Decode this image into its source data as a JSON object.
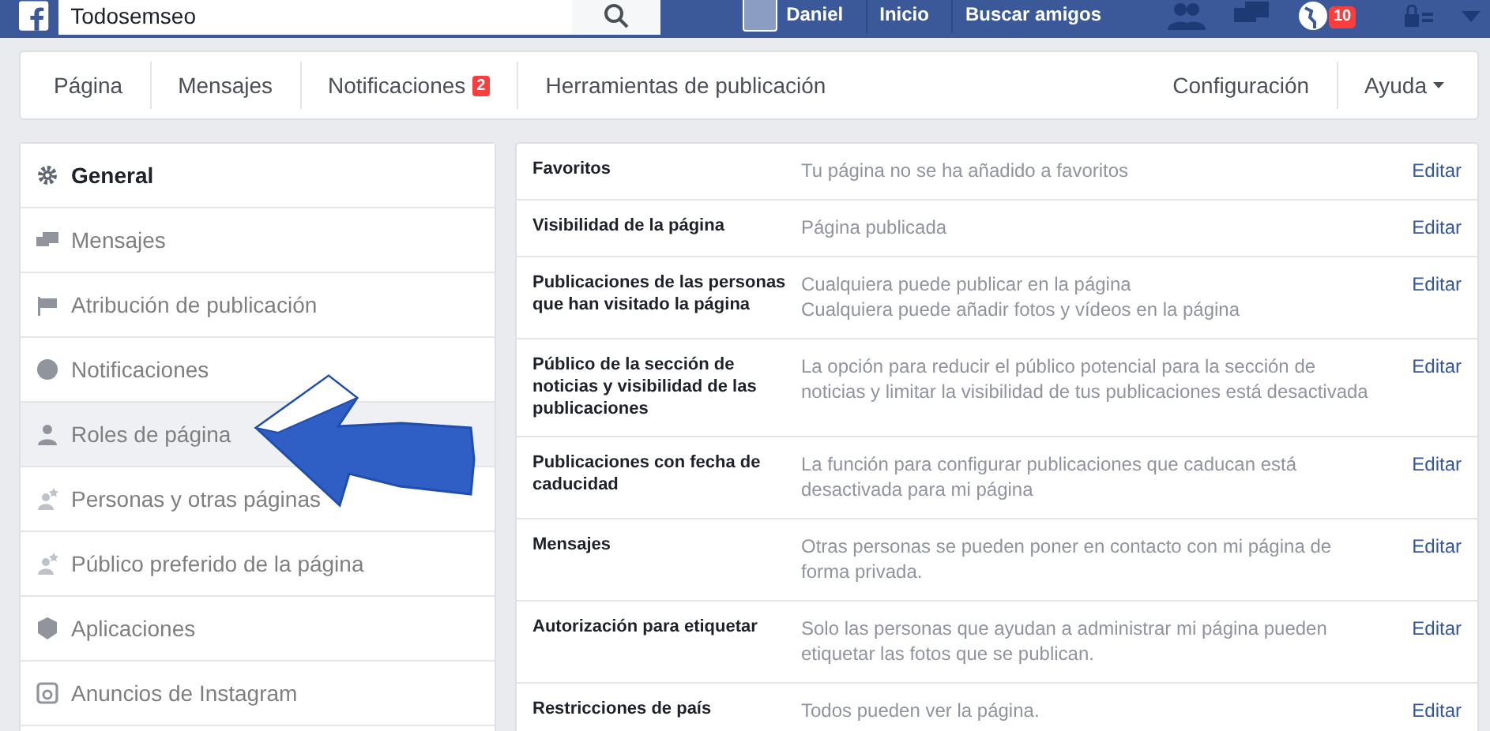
{
  "topbar": {
    "search": {
      "value": "Todosemseo"
    },
    "user": "Daniel",
    "links": [
      "Inicio",
      "Buscar amigos"
    ],
    "notification_badge": "10"
  },
  "nav": {
    "left": [
      {
        "label": "Página"
      },
      {
        "label": "Mensajes"
      },
      {
        "label": "Notificaciones",
        "badge": "2"
      },
      {
        "label": "Herramientas de publicación"
      }
    ],
    "right": [
      {
        "label": "Configuración",
        "caret": false
      },
      {
        "label": "Ayuda",
        "caret": true
      }
    ]
  },
  "sidebar": {
    "items": [
      {
        "label": "General",
        "selected": true,
        "hovered": false
      },
      {
        "label": "Mensajes",
        "selected": false,
        "hovered": false
      },
      {
        "label": "Atribución de publicación",
        "selected": false,
        "hovered": false
      },
      {
        "label": "Notificaciones",
        "selected": false,
        "hovered": false
      },
      {
        "label": "Roles de página",
        "selected": false,
        "hovered": true
      },
      {
        "label": "Personas y otras páginas",
        "selected": false,
        "hovered": false
      },
      {
        "label": "Público preferido de la página",
        "selected": false,
        "hovered": false
      },
      {
        "label": "Aplicaciones",
        "selected": false,
        "hovered": false
      },
      {
        "label": "Anuncios de Instagram",
        "selected": false,
        "hovered": false
      }
    ]
  },
  "settings": {
    "rows": [
      {
        "name": "Favoritos",
        "lines": [
          "Tu página no se ha añadido a favoritos"
        ],
        "action": "Editar"
      },
      {
        "name": "Visibilidad de la página",
        "lines": [
          "Página publicada"
        ],
        "action": "Editar"
      },
      {
        "name": "Publicaciones de las personas que han visitado la página",
        "lines": [
          "Cualquiera puede publicar en la página",
          "Cualquiera puede añadir fotos y vídeos en la página"
        ],
        "action": "Editar"
      },
      {
        "name": "Público de la sección de noticias y visibilidad de las publicaciones",
        "lines": [
          "La opción para reducir el público potencial para la sección de",
          "noticias y limitar la visibilidad de tus publicaciones está desactivada"
        ],
        "action": "Editar"
      },
      {
        "name": "Publicaciones con fecha de caducidad",
        "lines": [
          "La función para configurar publicaciones que caducan está",
          "desactivada para mi página"
        ],
        "action": "Editar"
      },
      {
        "name": "Mensajes",
        "lines": [
          "Otras personas se pueden poner en contacto con mi página de",
          "forma privada."
        ],
        "action": "Editar"
      },
      {
        "name": "Autorización para etiquetar",
        "lines": [
          "Solo las personas que ayudan a administrar mi página pueden",
          "etiquetar las fotos que se publican."
        ],
        "action": "Editar"
      },
      {
        "name": "Restricciones de país",
        "lines": [
          "Todos pueden ver la página."
        ],
        "action": "Editar"
      }
    ]
  }
}
